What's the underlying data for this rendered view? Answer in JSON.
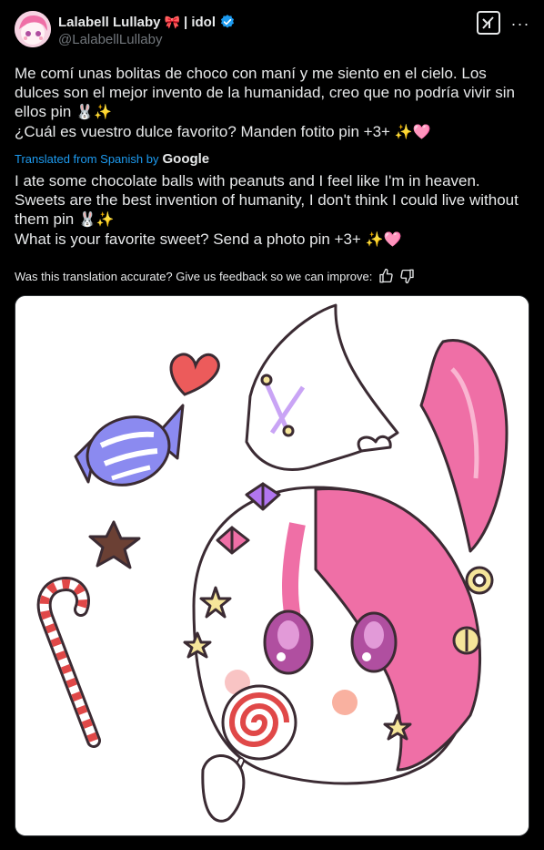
{
  "author": {
    "display_name": "Lalabell Lullaby",
    "bow_emoji": "🎀",
    "suffix": "| idol",
    "handle": "@LalabellLullaby",
    "verified": true
  },
  "actions": {
    "grok_icon": "grok-icon",
    "more_icon": "more-icon",
    "more_symbol": "···"
  },
  "original_text": {
    "line1": "Me comí unas bolitas de choco con maní y me siento en el cielo. Los dulces son el mejor invento de la humanidad, creo que no podría vivir sin ellos pin",
    "line1_emojis": "🐰✨",
    "line2": "¿Cuál es vuestro dulce favorito? Manden fotito pin +3+",
    "line2_emojis": "✨🩷"
  },
  "translation": {
    "label": "Translated from Spanish by",
    "provider": "Google",
    "line1": "I ate some chocolate balls with peanuts and I feel like I'm in heaven. Sweets are the best invention of humanity, I don't think I could live without them pin",
    "line1_emojis": "🐰✨",
    "line2": "What is your favorite sweet? Send a photo pin +3+",
    "line2_emojis": "✨🩷"
  },
  "feedback": {
    "prompt": "Was this translation accurate? Give us feedback so we can improve:"
  },
  "colors": {
    "background": "#000000",
    "text": "#e7e9ea",
    "muted": "#71767b",
    "accent": "#1d9bf0",
    "pink": "#ef6fa6"
  }
}
